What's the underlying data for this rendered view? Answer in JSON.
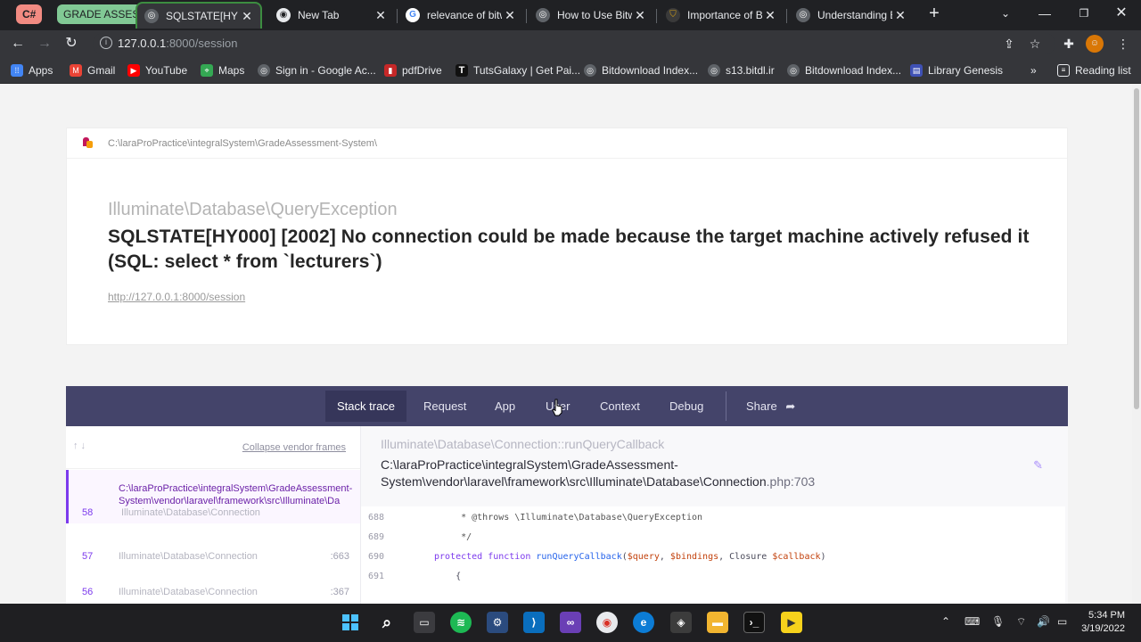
{
  "browser": {
    "tab_groups": [
      {
        "label": "C#",
        "color": "#f28b82"
      },
      {
        "label": "GRADE ASSES",
        "color": "#81c995"
      }
    ],
    "tabs": [
      {
        "title": "SQLSTATE[HY",
        "active": true
      },
      {
        "title": "New Tab"
      },
      {
        "title": "relevance of bitw"
      },
      {
        "title": "How to Use Bitw"
      },
      {
        "title": "Importance of Bi"
      },
      {
        "title": "Understanding B"
      }
    ],
    "address": {
      "host": "127.0.0.1",
      "path": ":8000/session"
    },
    "bookmarks": [
      {
        "label": "Apps",
        "icon": "apps-grid-icon",
        "color": "#4285f4"
      },
      {
        "label": "Gmail",
        "icon": "gmail-icon",
        "color": "#ea4335"
      },
      {
        "label": "YouTube",
        "icon": "youtube-icon",
        "color": "#ff0000"
      },
      {
        "label": "Maps",
        "icon": "maps-icon",
        "color": "#34a853"
      },
      {
        "label": "Sign in - Google Ac...",
        "icon": "globe-icon",
        "color": "#5f6368"
      },
      {
        "label": "pdfDrive",
        "icon": "pdfdrive-icon",
        "color": "#c62828"
      },
      {
        "label": "TutsGalaxy | Get Pai...",
        "icon": "tutsgalaxy-icon",
        "color": "#111111"
      },
      {
        "label": "Bitdownload Index...",
        "icon": "globe-icon",
        "color": "#5f6368"
      },
      {
        "label": "s13.bitdl.ir",
        "icon": "globe-icon",
        "color": "#5f6368"
      },
      {
        "label": "Bitdownload Index...",
        "icon": "globe-icon",
        "color": "#5f6368"
      },
      {
        "label": "Library Genesis",
        "icon": "libgen-icon",
        "color": "#3f51b5"
      }
    ],
    "reading_list": "Reading list"
  },
  "error": {
    "path": "C:\\laraProPractice\\integralSystem\\GradeAssessment-System\\",
    "exception_class": "Illuminate\\Database\\QueryException",
    "message": "SQLSTATE[HY000] [2002] No connection could be made because the target machine actively refused it (SQL: select * from `lecturers`)",
    "url": "http://127.0.0.1:8000/session"
  },
  "tabs": [
    "Stack trace",
    "Request",
    "App",
    "User",
    "Context",
    "Debug"
  ],
  "share_label": "Share",
  "stack": {
    "collapse_label": "Collapse vendor frames",
    "active_frame_path": "C:\\laraProPractice\\integralSystem\\GradeAssessment-System\\vendor\\laravel\\framework\\src\\Illuminate\\Da",
    "frames": [
      {
        "num": "58",
        "cls": "Illuminate\\Database\\Connection",
        "line": ""
      },
      {
        "num": "57",
        "cls": "Illuminate\\Database\\Connection",
        "line": ":663"
      },
      {
        "num": "56",
        "cls": "Illuminate\\Database\\Connection",
        "line": ":367"
      }
    ]
  },
  "detail": {
    "method": "Illuminate\\Database\\Connection::runQueryCallback",
    "file": "C:\\laraProPractice\\integralSystem\\GradeAssessment-System\\vendor\\laravel\\framework\\src\\Illuminate\\Database\\Connection",
    "line_suffix": ".php:703",
    "code": [
      {
        "no": "688",
        "text": "     * @throws \\Illuminate\\Database\\QueryException"
      },
      {
        "no": "689",
        "text": "     */"
      },
      {
        "no": "690",
        "text": ""
      },
      {
        "no": "691",
        "text": "    {"
      }
    ],
    "line690": {
      "kw": "protected function ",
      "fn": "runQueryCallback",
      "args1": "(",
      "v1": "$query",
      "sep1": ", ",
      "v2": "$bindings",
      "sep2": ", Closure ",
      "v3": "$callback",
      "end": ")"
    }
  },
  "taskbar": {
    "time": "5:34 PM",
    "date": "3/19/2022"
  }
}
